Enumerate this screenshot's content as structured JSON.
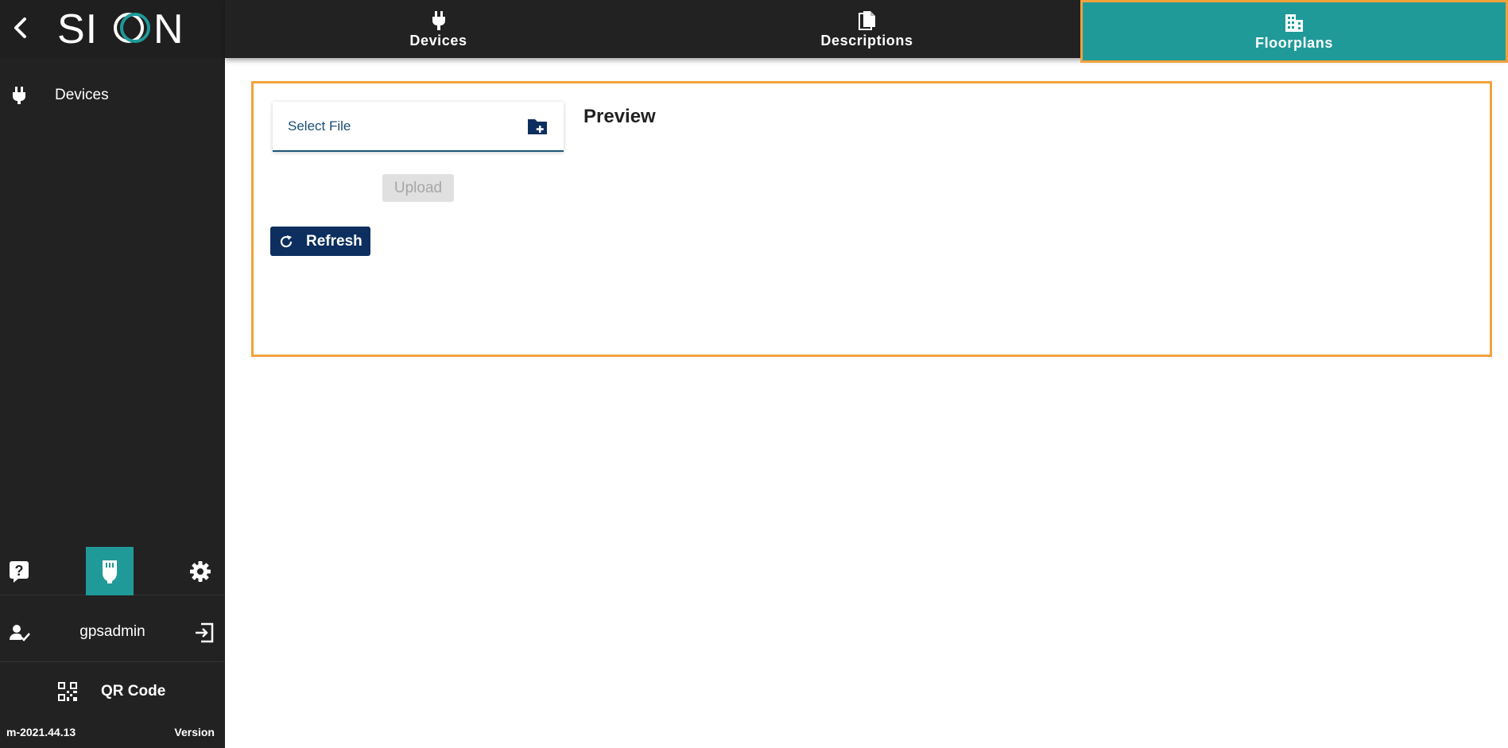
{
  "app": {
    "logo_text": "SICON"
  },
  "colors": {
    "accent": "#1f9a99",
    "highlight": "#f2a23c",
    "primary_button": "#0d2f5f",
    "sidebar_bg": "#222222"
  },
  "sidebar": {
    "nav_items": [
      {
        "label": "Devices",
        "icon": "plug-icon"
      }
    ],
    "tools": [
      {
        "icon": "help-icon"
      },
      {
        "icon": "device-icon",
        "active": true
      },
      {
        "icon": "gear-icon"
      }
    ],
    "user": {
      "name": "gpsadmin"
    },
    "qr": {
      "label": "QR Code"
    },
    "footer": {
      "version_number": "m-2021.44.13",
      "version_label": "Version"
    }
  },
  "tabs": [
    {
      "label": "Devices",
      "icon": "plug-icon"
    },
    {
      "label": "Descriptions",
      "icon": "documents-icon"
    },
    {
      "label": "Floorplans",
      "icon": "building-icon",
      "active": true
    }
  ],
  "main": {
    "file_select": {
      "label": "Select File"
    },
    "upload_label": "Upload",
    "refresh_label": "Refresh",
    "preview_title": "Preview"
  }
}
